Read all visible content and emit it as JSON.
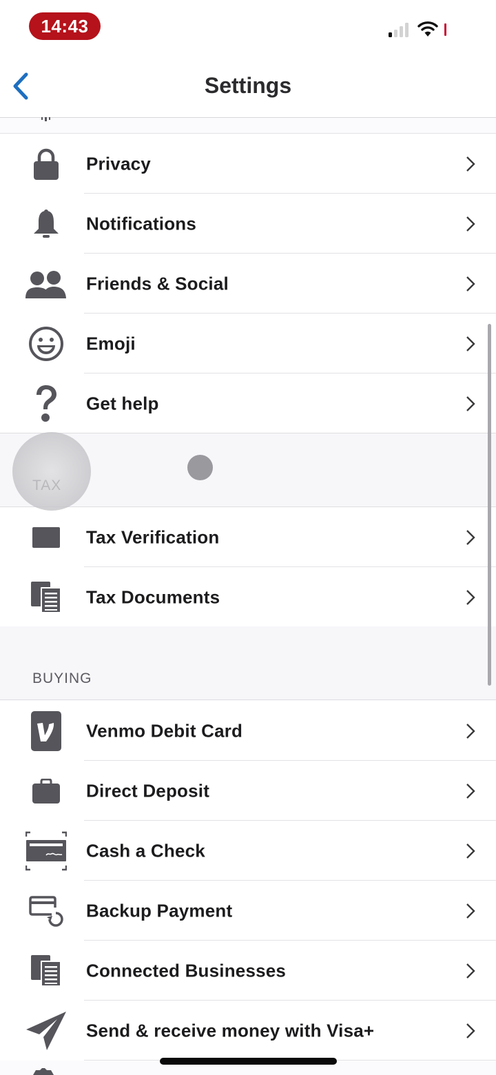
{
  "status_bar": {
    "time": "14:43",
    "signal_bars_active": 1,
    "signal_bars_total": 4,
    "wifi_icon": "wifi-icon",
    "accent_color": "#b5121b"
  },
  "navbar": {
    "back_icon": "chevron-left-icon",
    "back_color": "#1e6fc0",
    "title": "Settings"
  },
  "sections": {
    "general": {
      "items": [
        {
          "label": "Privacy",
          "icon": "lock-icon"
        },
        {
          "label": "Notifications",
          "icon": "bell-icon"
        },
        {
          "label": "Friends & Social",
          "icon": "people-icon"
        },
        {
          "label": "Emoji",
          "icon": "smiley-icon"
        },
        {
          "label": "Get help",
          "icon": "question-mark-icon"
        }
      ]
    },
    "tax": {
      "title": "TAX",
      "items": [
        {
          "label": "Tax Verification",
          "icon": "rectangle-icon"
        },
        {
          "label": "Tax Documents",
          "icon": "documents-icon"
        }
      ]
    },
    "buying": {
      "title": "BUYING",
      "items": [
        {
          "label": "Venmo Debit Card",
          "icon": "venmo-card-icon"
        },
        {
          "label": "Direct Deposit",
          "icon": "briefcase-icon"
        },
        {
          "label": "Cash a Check",
          "icon": "check-scan-icon"
        },
        {
          "label": "Backup Payment",
          "icon": "card-refresh-icon"
        },
        {
          "label": "Connected Businesses",
          "icon": "documents-icon"
        },
        {
          "label": "Send & receive money with Visa+",
          "icon": "paper-plane-icon"
        }
      ]
    }
  },
  "icon_color": "#55555b",
  "chevron_color": "#3a3a3c"
}
